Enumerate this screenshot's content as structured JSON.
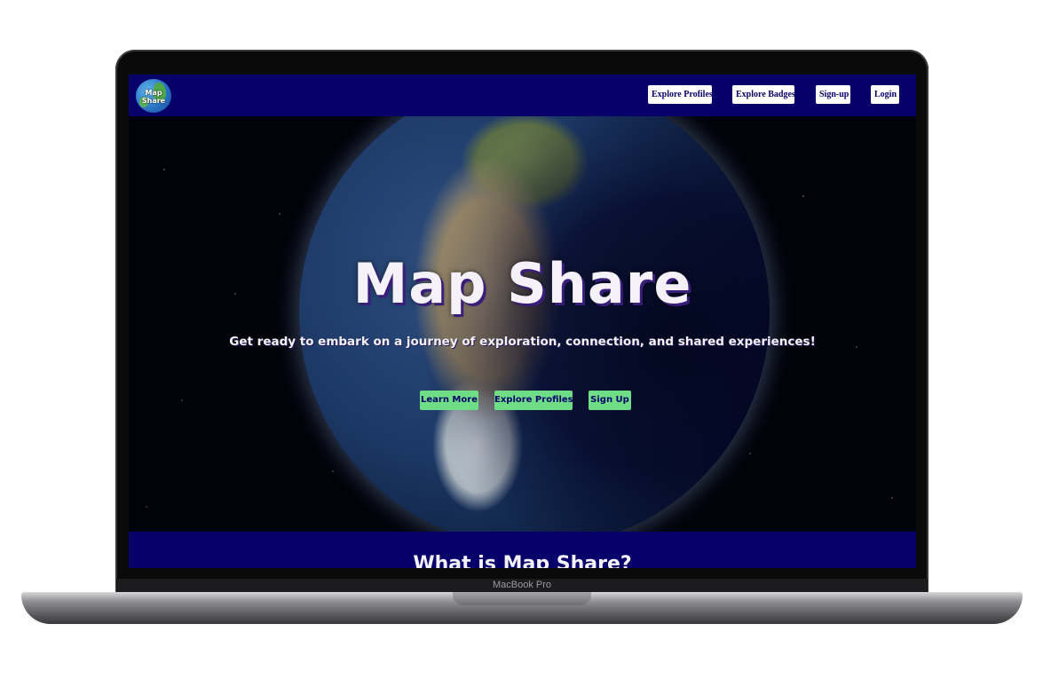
{
  "device": {
    "model_label": "MacBook Pro"
  },
  "navbar": {
    "logo_text": "Map Share",
    "links": [
      "Explore Profiles",
      "Explore Badges",
      "Sign-up",
      "Login"
    ]
  },
  "hero": {
    "title": "Map Share",
    "subtitle": "Get ready to embark on a journey of exploration, connection, and shared experiences!",
    "buttons": [
      "Learn More",
      "Explore Profiles",
      "Sign Up"
    ]
  },
  "about": {
    "title": "What is Map Share?"
  },
  "colors": {
    "nav_bg": "#07006b",
    "nav_button_bg": "#ffffff",
    "cta_bg": "#6fdc86",
    "title_text": "#f4f2f8"
  },
  "icons": {
    "logo": "globe-logo-icon"
  }
}
